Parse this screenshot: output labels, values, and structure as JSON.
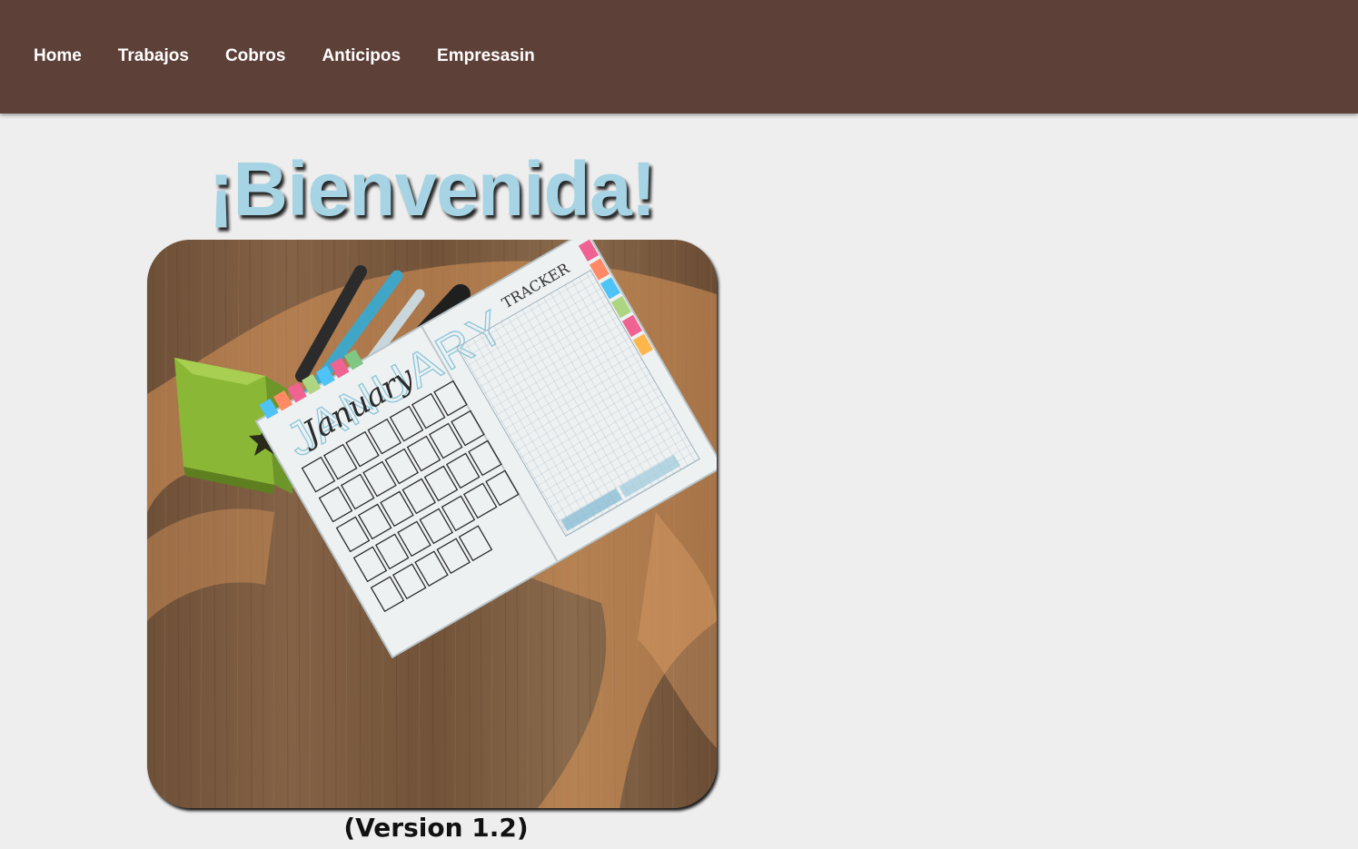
{
  "nav": {
    "items": [
      {
        "label": "Home"
      },
      {
        "label": "Trabajos"
      },
      {
        "label": "Cobros"
      },
      {
        "label": "Anticipos"
      },
      {
        "label": "Empresasin"
      }
    ]
  },
  "main": {
    "welcome_title": "¡Bienvenida!",
    "hero_image": {
      "calendar_month_big": "JANUARY",
      "calendar_month_script": "January",
      "tracker_label": "TRACKER"
    },
    "version_text": "(Version 1.2)"
  },
  "colors": {
    "navbar": "#5d4037",
    "background": "#eeeeee",
    "welcome_title": "#a6d4e4",
    "nav_text": "#ffffff"
  }
}
